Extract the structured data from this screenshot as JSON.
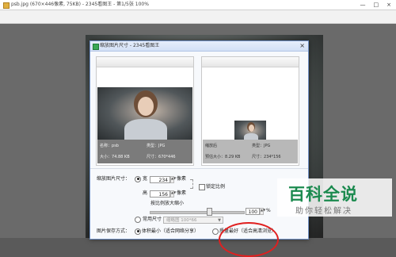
{
  "viewer": {
    "title": "psb.jpg (670×446像素, 75KB) - 2345看图王 - 第1/5张 100%",
    "controls": [
      "—",
      "□",
      "×"
    ]
  },
  "dialog": {
    "title": "缩放图片尺寸 - 2345看图王",
    "close": "×",
    "original": {
      "name_label": "名称：",
      "name_value": "psb",
      "type_label": "类型：",
      "type_value": "JPG",
      "size_label": "大小：",
      "size_value": "74.88 KB",
      "dim_label": "尺寸：",
      "dim_value": "670*446"
    },
    "preview": {
      "name_label": "缩放后",
      "type_label": "类型：",
      "type_value": "JPG",
      "size_label": "预估大小：",
      "size_value": "8.29 KB",
      "dim_label": "尺寸：",
      "dim_value": "234*156"
    },
    "settings": {
      "resize_label": "缩放图片尺寸：",
      "width_label": "宽",
      "width_value": "234",
      "height_label": "高",
      "height_value": "156",
      "unit": "像素",
      "lock_label": "锁定比例",
      "scale_label": "按比例放大缩小",
      "scale_value": "100",
      "percent": "%",
      "common_label": "常用尺寸",
      "common_value": "缩略图 100*66",
      "save_label": "图片保存方式：",
      "opt_small": "体积最小（适合网络分享）",
      "opt_quality": "质量最好（适合高清浏览）"
    }
  },
  "watermark": {
    "main": "百科全说",
    "sub": "助你轻松解决"
  }
}
